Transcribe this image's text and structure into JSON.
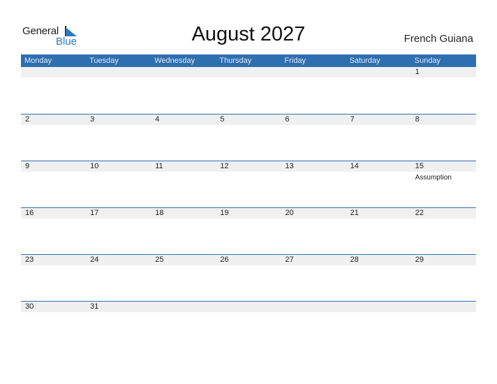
{
  "logo": {
    "line1": "General",
    "line2": "Blue"
  },
  "header": {
    "title": "August 2027",
    "region": "French Guiana"
  },
  "colors": {
    "accent": "#2e6fb0",
    "band": "#f0f0f0",
    "logo_blue": "#2a78c2"
  },
  "weekdays": [
    "Monday",
    "Tuesday",
    "Wednesday",
    "Thursday",
    "Friday",
    "Saturday",
    "Sunday"
  ],
  "weeks": [
    [
      {
        "d": ""
      },
      {
        "d": ""
      },
      {
        "d": ""
      },
      {
        "d": ""
      },
      {
        "d": ""
      },
      {
        "d": ""
      },
      {
        "d": "1"
      }
    ],
    [
      {
        "d": "2"
      },
      {
        "d": "3"
      },
      {
        "d": "4"
      },
      {
        "d": "5"
      },
      {
        "d": "6"
      },
      {
        "d": "7"
      },
      {
        "d": "8"
      }
    ],
    [
      {
        "d": "9"
      },
      {
        "d": "10"
      },
      {
        "d": "11"
      },
      {
        "d": "12"
      },
      {
        "d": "13"
      },
      {
        "d": "14"
      },
      {
        "d": "15",
        "holiday": "Assumption"
      }
    ],
    [
      {
        "d": "16"
      },
      {
        "d": "17"
      },
      {
        "d": "18"
      },
      {
        "d": "19"
      },
      {
        "d": "20"
      },
      {
        "d": "21"
      },
      {
        "d": "22"
      }
    ],
    [
      {
        "d": "23"
      },
      {
        "d": "24"
      },
      {
        "d": "25"
      },
      {
        "d": "26"
      },
      {
        "d": "27"
      },
      {
        "d": "28"
      },
      {
        "d": "29"
      }
    ],
    [
      {
        "d": "30"
      },
      {
        "d": "31"
      },
      {
        "d": ""
      },
      {
        "d": ""
      },
      {
        "d": ""
      },
      {
        "d": ""
      },
      {
        "d": ""
      }
    ]
  ]
}
